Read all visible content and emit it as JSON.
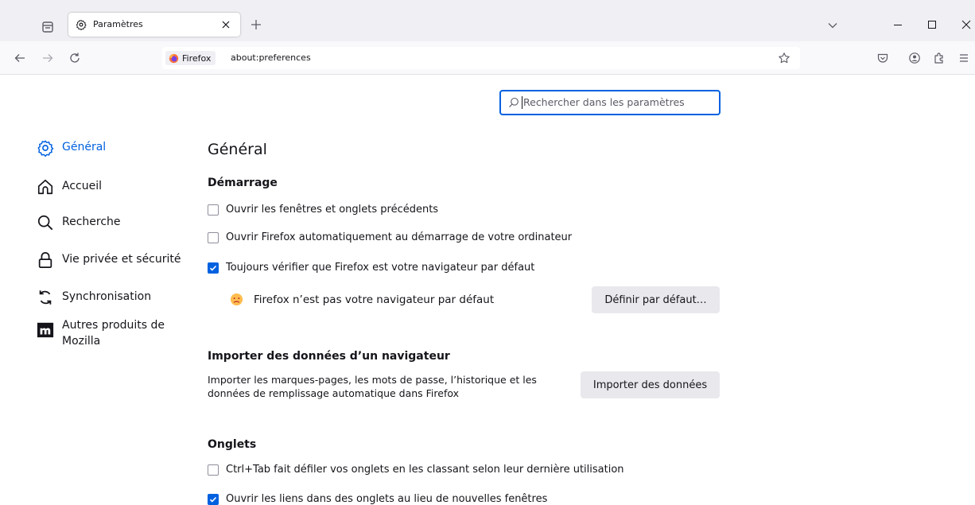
{
  "browser": {
    "tab": {
      "title": "Paramètres"
    },
    "url": {
      "identity": "Firefox",
      "text": "about:preferences"
    }
  },
  "search": {
    "placeholder": "Rechercher dans les paramètres"
  },
  "sidebar": {
    "items": [
      {
        "label": "Général",
        "icon": "gear-icon"
      },
      {
        "label": "Accueil",
        "icon": "home-icon"
      },
      {
        "label": "Recherche",
        "icon": "search-icon"
      },
      {
        "label": "Vie privée et sécurité",
        "icon": "lock-icon"
      },
      {
        "label": "Synchronisation",
        "icon": "sync-icon"
      },
      {
        "label": "Autres produits de Mozilla",
        "icon": "mozilla-icon"
      }
    ]
  },
  "main": {
    "title": "Général",
    "startup": {
      "heading": "Démarrage",
      "opt1": "Ouvrir les fenêtres et onglets précédents",
      "opt2": "Ouvrir Firefox automatiquement au démarrage de votre ordinateur",
      "opt3": "Toujours vérifier que Firefox est votre navigateur par défaut",
      "status": "Firefox n’est pas votre navigateur par défaut",
      "default_btn": "Définir par défaut…"
    },
    "import": {
      "heading": "Importer des données d’un navigateur",
      "desc": "Importer les marques-pages, les mots de passe, l’historique et les données de remplissage automatique dans Firefox",
      "btn": "Importer des données"
    },
    "tabs": {
      "heading": "Onglets",
      "opt1": "Ctrl+Tab fait défiler vos onglets en les classant selon leur dernière utilisation",
      "opt2": "Ouvrir les liens dans des onglets au lieu de nouvelles fenêtres"
    }
  },
  "colors": {
    "accent": "#0061e0",
    "button_bg": "#e9e9ed"
  }
}
